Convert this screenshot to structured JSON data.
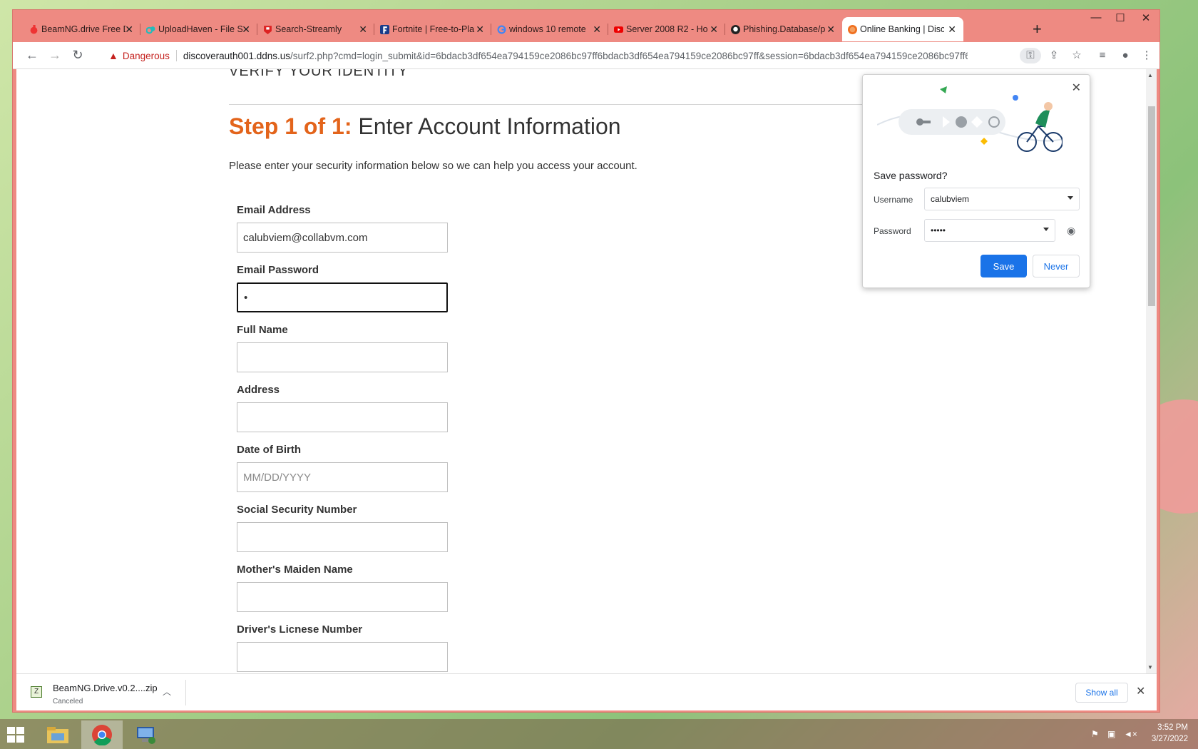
{
  "browser": {
    "tabs": [
      {
        "title": "BeamNG.drive Free D",
        "favicon": "beamng-icon",
        "color": "#e33"
      },
      {
        "title": "UploadHaven - File S",
        "favicon": "uploadhaven-icon",
        "color": "#2bb"
      },
      {
        "title": "Search-Streamly",
        "favicon": "streamly-icon",
        "color": "#d22"
      },
      {
        "title": "Fortnite | Free-to-Pla",
        "favicon": "fortnite-icon",
        "color": "#1a3c8a"
      },
      {
        "title": "windows 10 remote",
        "favicon": "google-icon",
        "color": "#4285f4"
      },
      {
        "title": "Server 2008 R2 - Ho",
        "favicon": "youtube-icon",
        "color": "#e00"
      },
      {
        "title": "Phishing.Database/p",
        "favicon": "github-icon",
        "color": "#222"
      },
      {
        "title": "Online Banking | Disc",
        "favicon": "discover-icon",
        "color": "#f07020"
      }
    ],
    "security_label": "Dangerous",
    "url_host": "discoverauth001.ddns.us",
    "url_path": "/surf2.php?cmd=login_submit&id=6bdacb3df654ea794159ce2086bc97ff6bdacb3df654ea794159ce2086bc97ff&session=6bdacb3df654ea794159ce2086bc97ff6b..."
  },
  "page": {
    "verify_text": "VERIFY YOUR IDENTITY",
    "step_label": "Step 1 of 1:",
    "heading": "Enter Account Information",
    "intro": "Please enter your security information below so we can help you access your account.",
    "fields": [
      {
        "label": "Email Address",
        "value": "calubviem@collabvm.com",
        "placeholder": ""
      },
      {
        "label": "Email Password",
        "value": "•",
        "placeholder": ""
      },
      {
        "label": "Full Name",
        "value": "",
        "placeholder": ""
      },
      {
        "label": "Address",
        "value": "",
        "placeholder": ""
      },
      {
        "label": "Date of Birth",
        "value": "",
        "placeholder": "MM/DD/YYYY"
      },
      {
        "label": "Social Security Number",
        "value": "",
        "placeholder": ""
      },
      {
        "label": "Mother's Maiden Name",
        "value": "",
        "placeholder": ""
      },
      {
        "label": "Driver's Licnese Number",
        "value": "",
        "placeholder": ""
      }
    ]
  },
  "save_password": {
    "title": "Save password?",
    "username_label": "Username",
    "username_value": "calubviem",
    "password_label": "Password",
    "password_value": "•••••",
    "save_label": "Save",
    "never_label": "Never"
  },
  "downloads": {
    "file_name": "BeamNG.Drive.v0.2....zip",
    "status": "Canceled",
    "show_all": "Show all"
  },
  "taskbar": {
    "time": "3:52 PM",
    "date": "3/27/2022"
  },
  "colors": {
    "accent_orange": "#e3641b",
    "chrome_blue": "#1a73e8",
    "window_frame": "#ee8a82"
  }
}
